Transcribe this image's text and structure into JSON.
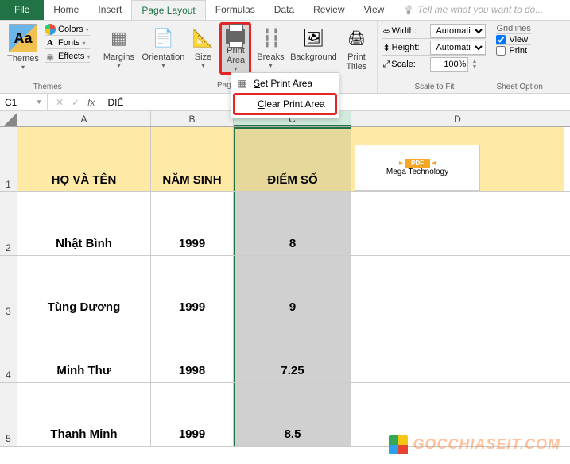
{
  "tabs": {
    "file": "File",
    "home": "Home",
    "insert": "Insert",
    "page_layout": "Page Layout",
    "formulas": "Formulas",
    "data": "Data",
    "review": "Review",
    "view": "View",
    "tell_me": "Tell me what you want to do..."
  },
  "ribbon": {
    "themes": {
      "label": "Themes",
      "btn": "Themes",
      "colors": "Colors",
      "fonts": "Fonts",
      "effects": "Effects"
    },
    "page_setup": {
      "label_partial": "Pag",
      "margins": "Margins",
      "orientation": "Orientation",
      "size": "Size",
      "print_area": "Print\nArea",
      "breaks": "Breaks",
      "background": "Background",
      "print_titles": "Print\nTitles"
    },
    "dropdown": {
      "set": "Set Print Area",
      "clear": "Clear Print Area"
    },
    "scale": {
      "label": "Scale to Fit",
      "width": "Width:",
      "height": "Height:",
      "scale": "Scale:",
      "auto": "Automatic",
      "scale_val": "100%"
    },
    "sheet": {
      "label": "Sheet Option",
      "gridlines": "Gridlines",
      "view": "View",
      "print": "Print"
    }
  },
  "fbar": {
    "name": "C1",
    "fx": "fx",
    "value": "ĐIỂ"
  },
  "cols": {
    "A": "A",
    "B": "B",
    "C": "C",
    "D": "D"
  },
  "rows": [
    "1",
    "2",
    "3",
    "4",
    "5"
  ],
  "data": {
    "headers": {
      "A": "HỌ VÀ TÊN",
      "B": "NĂM SINH",
      "C": "ĐIỂM SỐ"
    },
    "r2": {
      "A": "Nhật Bình",
      "B": "1999",
      "C": "8"
    },
    "r3": {
      "A": "Tùng Dương",
      "B": "1999",
      "C": "9"
    },
    "r4": {
      "A": "Minh Thư",
      "B": "1998",
      "C": "7.25"
    },
    "r5": {
      "A": "Thanh Minh",
      "B": "1999",
      "C": "8.5"
    }
  },
  "megatech": {
    "pdf": "PDF",
    "label": "Mega Technology"
  },
  "watermark": "GOCCHIASEIT.COM"
}
